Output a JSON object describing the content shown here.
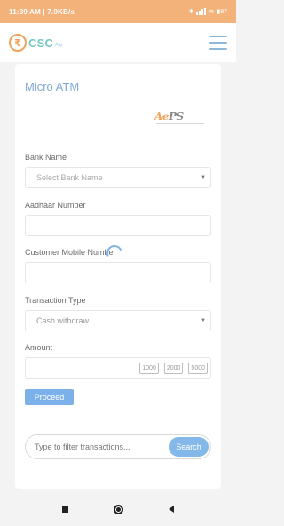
{
  "status_bar": {
    "time": "11:39 AM | 7.9KB/s",
    "icons": [
      "bluetooth-icon",
      "signal-icon",
      "wifi-icon",
      "battery-icon"
    ],
    "battery": "87"
  },
  "app_bar": {
    "logo_symbol": "₹",
    "logo_brand": "CSC",
    "logo_sub": "Pay",
    "menu_icon": "hamburger-menu-icon"
  },
  "page": {
    "title": "Micro ATM",
    "logo": {
      "prefix": "A",
      "highlight": "e",
      "suffix": "PS"
    }
  },
  "form": {
    "bank": {
      "label": "Bank Name",
      "value": "Select Bank Name"
    },
    "aadhaar": {
      "label": "Aadhaar Number",
      "value": ""
    },
    "mobile": {
      "label": "Customer Mobile Number",
      "value": ""
    },
    "transaction_type": {
      "label": "Transaction Type",
      "value": "Cash withdraw"
    },
    "amount": {
      "label": "Amount",
      "value": "",
      "quick": [
        "1000",
        "2000",
        "5000"
      ]
    },
    "proceed_label": "Proceed"
  },
  "filter": {
    "placeholder": "Type to filter transactions...",
    "search_label": "Search"
  },
  "colors": {
    "status_bar": "#f4b27b",
    "accent": "#7bb1e8",
    "title": "#7fa8d4",
    "brand_orange": "#f0a35b",
    "brand_teal": "#78c6c0"
  }
}
